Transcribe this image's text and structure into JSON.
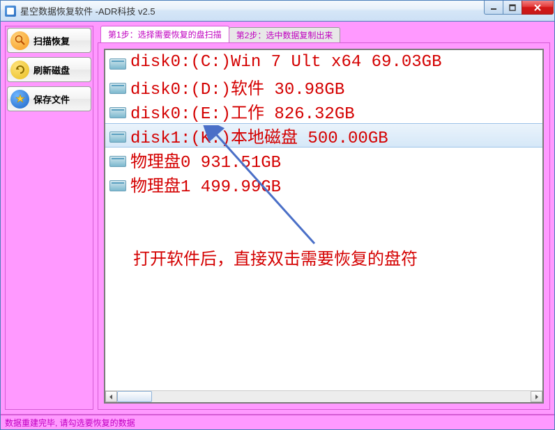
{
  "window": {
    "title": "星空数据恢复软件   -ADR科技 v2.5"
  },
  "sidebar": {
    "scan_label": "扫描恢复",
    "refresh_label": "刷新磁盘",
    "save_label": "保存文件"
  },
  "tabs": {
    "step1": "第1步：选择需要恢复的盘扫描",
    "step2": "第2步：选中数据复制出来"
  },
  "disks": [
    {
      "label": "disk0:(C:)Win 7 Ult x64 69.03GB",
      "selected": false
    },
    {
      "label": "disk0:(D:)软件 30.98GB",
      "selected": false
    },
    {
      "label": "disk0:(E:)工作 826.32GB",
      "selected": false
    },
    {
      "label": "disk1:(K:)本地磁盘 500.00GB",
      "selected": true
    },
    {
      "label": "物理盘0 931.51GB",
      "selected": false
    },
    {
      "label": "物理盘1 499.99GB",
      "selected": false
    }
  ],
  "annotation": "打开软件后，直接双击需要恢复的盘符",
  "status": "数据重建完毕, 请勾选要恢复的数据"
}
